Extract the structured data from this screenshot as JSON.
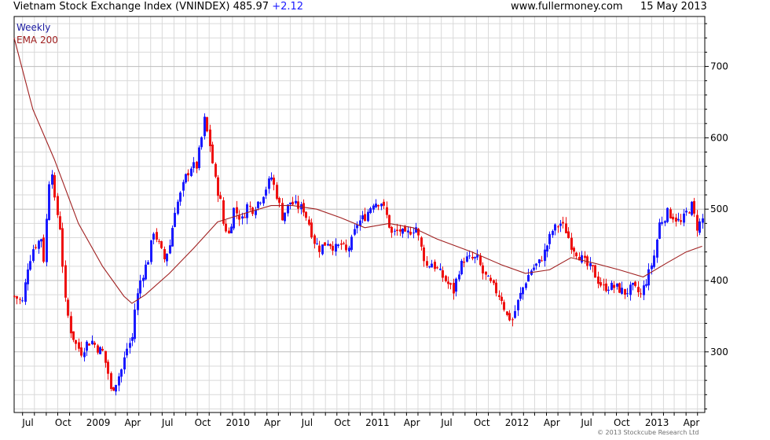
{
  "header": {
    "title": "Vietnam Stock Exchange Index (VNINDEX) 485.97",
    "change": "+2.12",
    "site": "www.fullermoney.com",
    "date": "15 May 2013"
  },
  "copyright": "© 2013 Stockcube Research Ltd",
  "colors": {
    "up": "#1a1aff",
    "down": "#ee1111",
    "ema": "#a02020",
    "grid": "#d9d9d9",
    "frame": "#000000"
  },
  "chart_data": {
    "type": "candlestick",
    "title": "Vietnam Stock Exchange Index (VNINDEX) 485.97 +2.12",
    "legend": [
      "Weekly",
      "EMA 200"
    ],
    "x_tick_labels": [
      "Jul",
      "Oct",
      "2009",
      "Apr",
      "Jul",
      "Oct",
      "2010",
      "Apr",
      "Jul",
      "Oct",
      "2011",
      "Apr",
      "Jul",
      "Oct",
      "2012",
      "Apr",
      "Jul",
      "Oct",
      "2013",
      "Apr"
    ],
    "y_tick_labels": [
      "300",
      "400",
      "500",
      "600",
      "700"
    ],
    "ylim": [
      215,
      770
    ],
    "xlim": [
      "2008-06-09",
      "2013-05-20"
    ],
    "grid": true,
    "weekly_closes": [
      [
        "2008-06-09",
        378
      ],
      [
        "2008-06-30",
        370
      ],
      [
        "2008-07-14",
        420
      ],
      [
        "2008-07-28",
        445
      ],
      [
        "2008-08-18",
        460
      ],
      [
        "2008-08-25",
        430
      ],
      [
        "2008-09-08",
        540
      ],
      [
        "2008-09-15",
        555
      ],
      [
        "2008-09-22",
        510
      ],
      [
        "2008-10-06",
        475
      ],
      [
        "2008-10-20",
        370
      ],
      [
        "2008-11-03",
        330
      ],
      [
        "2008-11-17",
        310
      ],
      [
        "2008-12-01",
        300
      ],
      [
        "2008-12-15",
        312
      ],
      [
        "2008-12-29",
        315
      ],
      [
        "2009-01-12",
        305
      ],
      [
        "2009-01-26",
        300
      ],
      [
        "2009-02-09",
        270
      ],
      [
        "2009-02-16",
        245
      ],
      [
        "2009-03-02",
        258
      ],
      [
        "2009-03-16",
        275
      ],
      [
        "2009-03-30",
        305
      ],
      [
        "2009-04-13",
        320
      ],
      [
        "2009-04-20",
        360
      ],
      [
        "2009-05-04",
        400
      ],
      [
        "2009-05-25",
        430
      ],
      [
        "2009-06-08",
        470
      ],
      [
        "2009-06-22",
        450
      ],
      [
        "2009-07-06",
        430
      ],
      [
        "2009-07-20",
        450
      ],
      [
        "2009-08-03",
        500
      ],
      [
        "2009-08-17",
        520
      ],
      [
        "2009-08-31",
        545
      ],
      [
        "2009-09-14",
        560
      ],
      [
        "2009-09-28",
        560
      ],
      [
        "2009-10-12",
        600
      ],
      [
        "2009-10-19",
        625
      ],
      [
        "2009-11-02",
        590
      ],
      [
        "2009-11-16",
        540
      ],
      [
        "2009-11-30",
        510
      ],
      [
        "2009-12-07",
        480
      ],
      [
        "2009-12-21",
        465
      ],
      [
        "2010-01-04",
        500
      ],
      [
        "2010-01-25",
        485
      ],
      [
        "2010-02-08",
        505
      ],
      [
        "2010-02-22",
        500
      ],
      [
        "2010-03-15",
        515
      ],
      [
        "2010-03-29",
        530
      ],
      [
        "2010-04-12",
        545
      ],
      [
        "2010-04-26",
        520
      ],
      [
        "2010-05-10",
        490
      ],
      [
        "2010-05-31",
        510
      ],
      [
        "2010-06-14",
        505
      ],
      [
        "2010-07-05",
        500
      ],
      [
        "2010-07-19",
        480
      ],
      [
        "2010-08-02",
        455
      ],
      [
        "2010-08-16",
        445
      ],
      [
        "2010-09-06",
        455
      ],
      [
        "2010-09-27",
        445
      ],
      [
        "2010-10-11",
        450
      ],
      [
        "2010-10-25",
        440
      ],
      [
        "2010-11-08",
        455
      ],
      [
        "2010-11-22",
        480
      ],
      [
        "2010-12-13",
        490
      ],
      [
        "2011-01-03",
        510
      ],
      [
        "2011-01-24",
        510
      ],
      [
        "2011-02-07",
        490
      ],
      [
        "2011-02-21",
        465
      ],
      [
        "2011-03-14",
        470
      ],
      [
        "2011-03-28",
        462
      ],
      [
        "2011-04-11",
        470
      ],
      [
        "2011-04-25",
        475
      ],
      [
        "2011-05-09",
        445
      ],
      [
        "2011-05-23",
        420
      ],
      [
        "2011-06-06",
        425
      ],
      [
        "2011-06-27",
        410
      ],
      [
        "2011-07-18",
        395
      ],
      [
        "2011-08-01",
        385
      ],
      [
        "2011-08-15",
        415
      ],
      [
        "2011-08-29",
        430
      ],
      [
        "2011-09-12",
        430
      ],
      [
        "2011-10-03",
        430
      ],
      [
        "2011-10-17",
        410
      ],
      [
        "2011-11-07",
        395
      ],
      [
        "2011-11-21",
        385
      ],
      [
        "2011-12-05",
        375
      ],
      [
        "2011-12-19",
        350
      ],
      [
        "2012-01-02",
        345
      ],
      [
        "2012-01-16",
        370
      ],
      [
        "2012-02-06",
        400
      ],
      [
        "2012-02-20",
        415
      ],
      [
        "2012-03-12",
        425
      ],
      [
        "2012-03-26",
        440
      ],
      [
        "2012-04-16",
        470
      ],
      [
        "2012-05-07",
        480
      ],
      [
        "2012-05-21",
        470
      ],
      [
        "2012-06-04",
        450
      ],
      [
        "2012-06-25",
        435
      ],
      [
        "2012-07-16",
        420
      ],
      [
        "2012-07-30",
        415
      ],
      [
        "2012-08-13",
        400
      ],
      [
        "2012-08-27",
        390
      ],
      [
        "2012-09-10",
        392
      ],
      [
        "2012-10-01",
        390
      ],
      [
        "2012-10-22",
        383
      ],
      [
        "2012-11-12",
        390
      ],
      [
        "2012-12-03",
        380
      ],
      [
        "2012-12-24",
        410
      ],
      [
        "2013-01-07",
        435
      ],
      [
        "2013-01-21",
        480
      ],
      [
        "2013-02-11",
        495
      ],
      [
        "2013-02-25",
        490
      ],
      [
        "2013-03-18",
        480
      ],
      [
        "2013-04-01",
        495
      ],
      [
        "2013-04-15",
        505
      ],
      [
        "2013-04-29",
        475
      ],
      [
        "2013-05-13",
        486
      ]
    ],
    "ema_200": [
      [
        "2008-06-09",
        740
      ],
      [
        "2008-07-28",
        640
      ],
      [
        "2008-09-22",
        570
      ],
      [
        "2008-11-24",
        480
      ],
      [
        "2009-01-26",
        420
      ],
      [
        "2009-03-23",
        378
      ],
      [
        "2009-04-13",
        368
      ],
      [
        "2009-05-18",
        380
      ],
      [
        "2009-07-20",
        410
      ],
      [
        "2009-09-21",
        445
      ],
      [
        "2009-11-23",
        482
      ],
      [
        "2010-02-01",
        494
      ],
      [
        "2010-04-12",
        505
      ],
      [
        "2010-06-07",
        505
      ],
      [
        "2010-08-09",
        500
      ],
      [
        "2010-10-11",
        488
      ],
      [
        "2010-12-13",
        474
      ],
      [
        "2011-02-14",
        480
      ],
      [
        "2011-04-18",
        474
      ],
      [
        "2011-06-20",
        458
      ],
      [
        "2011-09-19",
        440
      ],
      [
        "2011-12-05",
        422
      ],
      [
        "2012-02-06",
        410
      ],
      [
        "2012-04-09",
        415
      ],
      [
        "2012-06-04",
        432
      ],
      [
        "2012-08-06",
        424
      ],
      [
        "2012-10-08",
        415
      ],
      [
        "2012-12-10",
        405
      ],
      [
        "2013-02-11",
        425
      ],
      [
        "2013-04-01",
        440
      ],
      [
        "2013-05-13",
        448
      ]
    ]
  }
}
